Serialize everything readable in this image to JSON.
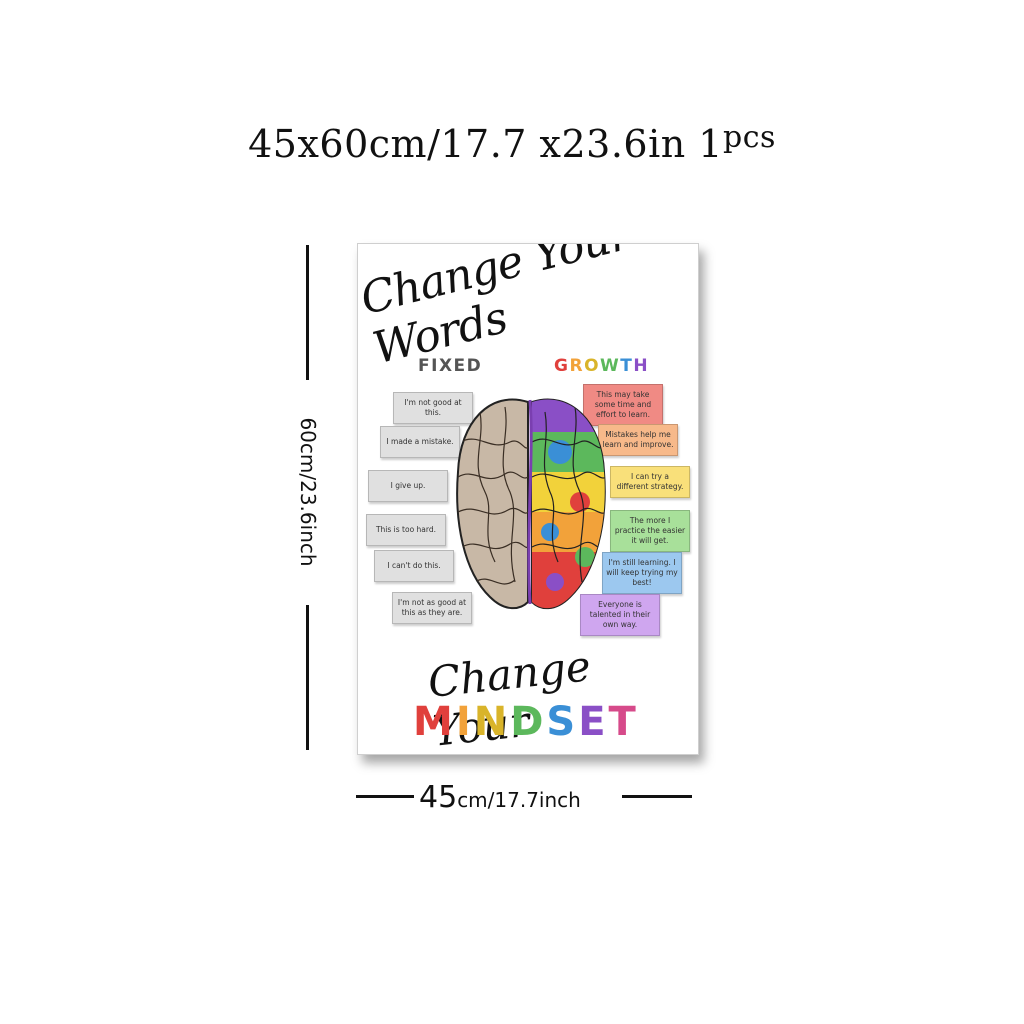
{
  "header": {
    "size_text": "45x60cm/17.7 x23.6in 1",
    "pcs": "pcs"
  },
  "dimensions": {
    "height_label": "60cm/23.6inch",
    "width_big": "45",
    "width_rest": "cm/17.7inch"
  },
  "poster": {
    "title_script": "Change Your Words",
    "fixed_heading": "FIXED",
    "growth_heading": [
      "G",
      "R",
      "O",
      "W",
      "T",
      "H"
    ],
    "fixed_cards": [
      "I'm not good at this.",
      "I made a mistake.",
      "I give up.",
      "This is too hard.",
      "I can't do this.",
      "I'm not as good at this as they are."
    ],
    "growth_cards": [
      "This may take some time and effort to learn.",
      "Mistakes help me learn and improve.",
      "I can try a different strategy.",
      "The more I practice the easier it will get.",
      "I'm still learning. I will keep trying my best!",
      "Everyone is talented in their own way."
    ],
    "growth_colors": [
      "#f08a84",
      "#f7b98a",
      "#f9e07a",
      "#a8e09a",
      "#9cc8ef",
      "#cfa6ef"
    ],
    "subtitle_script": "Change Your",
    "mindset_letters": [
      "M",
      "I",
      "N",
      "D",
      "S",
      "E",
      "T"
    ],
    "mindset_colors": [
      "#e0403c",
      "#f2a23a",
      "#d9b42a",
      "#5cb85c",
      "#3a8fd6",
      "#8a4fc6",
      "#d64a8a"
    ]
  }
}
